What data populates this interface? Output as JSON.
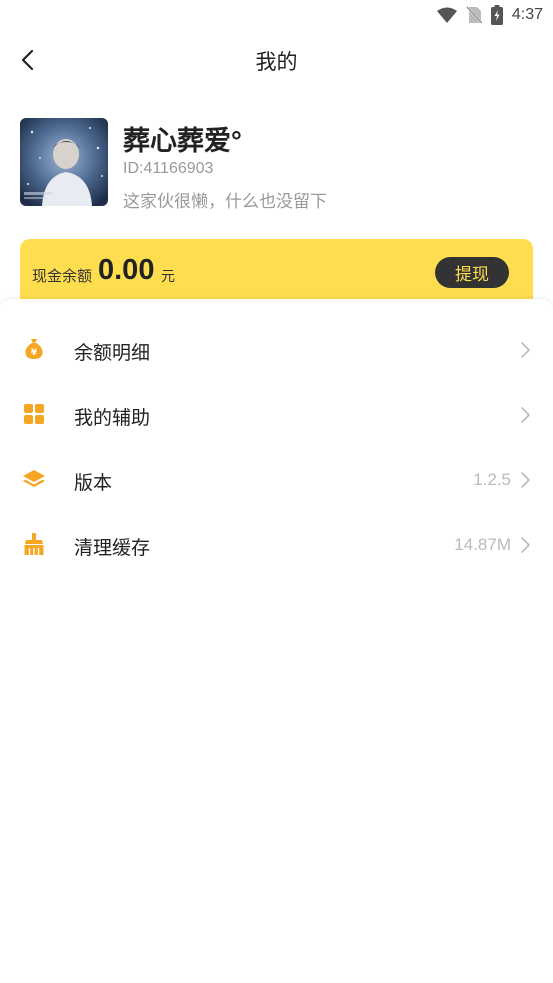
{
  "status_bar": {
    "time": "4:37",
    "icons": [
      "wifi-icon",
      "no-sim-icon",
      "battery-icon"
    ]
  },
  "header": {
    "title": "我的",
    "back_icon": "back-arrow-icon"
  },
  "profile": {
    "name": "葬心葬爱°",
    "id": "ID:41166903",
    "bio": "这家伙很懒，什么也没留下"
  },
  "balance": {
    "label": "现金余额",
    "amount": "0.00",
    "unit": "元",
    "withdraw_label": "提现",
    "card_color": "#fede4f"
  },
  "menu": [
    {
      "icon": "money-bag-icon",
      "label": "余额明细",
      "value": ""
    },
    {
      "icon": "grid-apps-icon",
      "label": "我的辅助",
      "value": ""
    },
    {
      "icon": "layers-icon",
      "label": "版本",
      "value": "1.2.5"
    },
    {
      "icon": "broom-icon",
      "label": "清理缓存",
      "value": "14.87M"
    }
  ],
  "colors": {
    "accent": "#f5a623",
    "card": "#fede4f",
    "button": "#333333"
  }
}
